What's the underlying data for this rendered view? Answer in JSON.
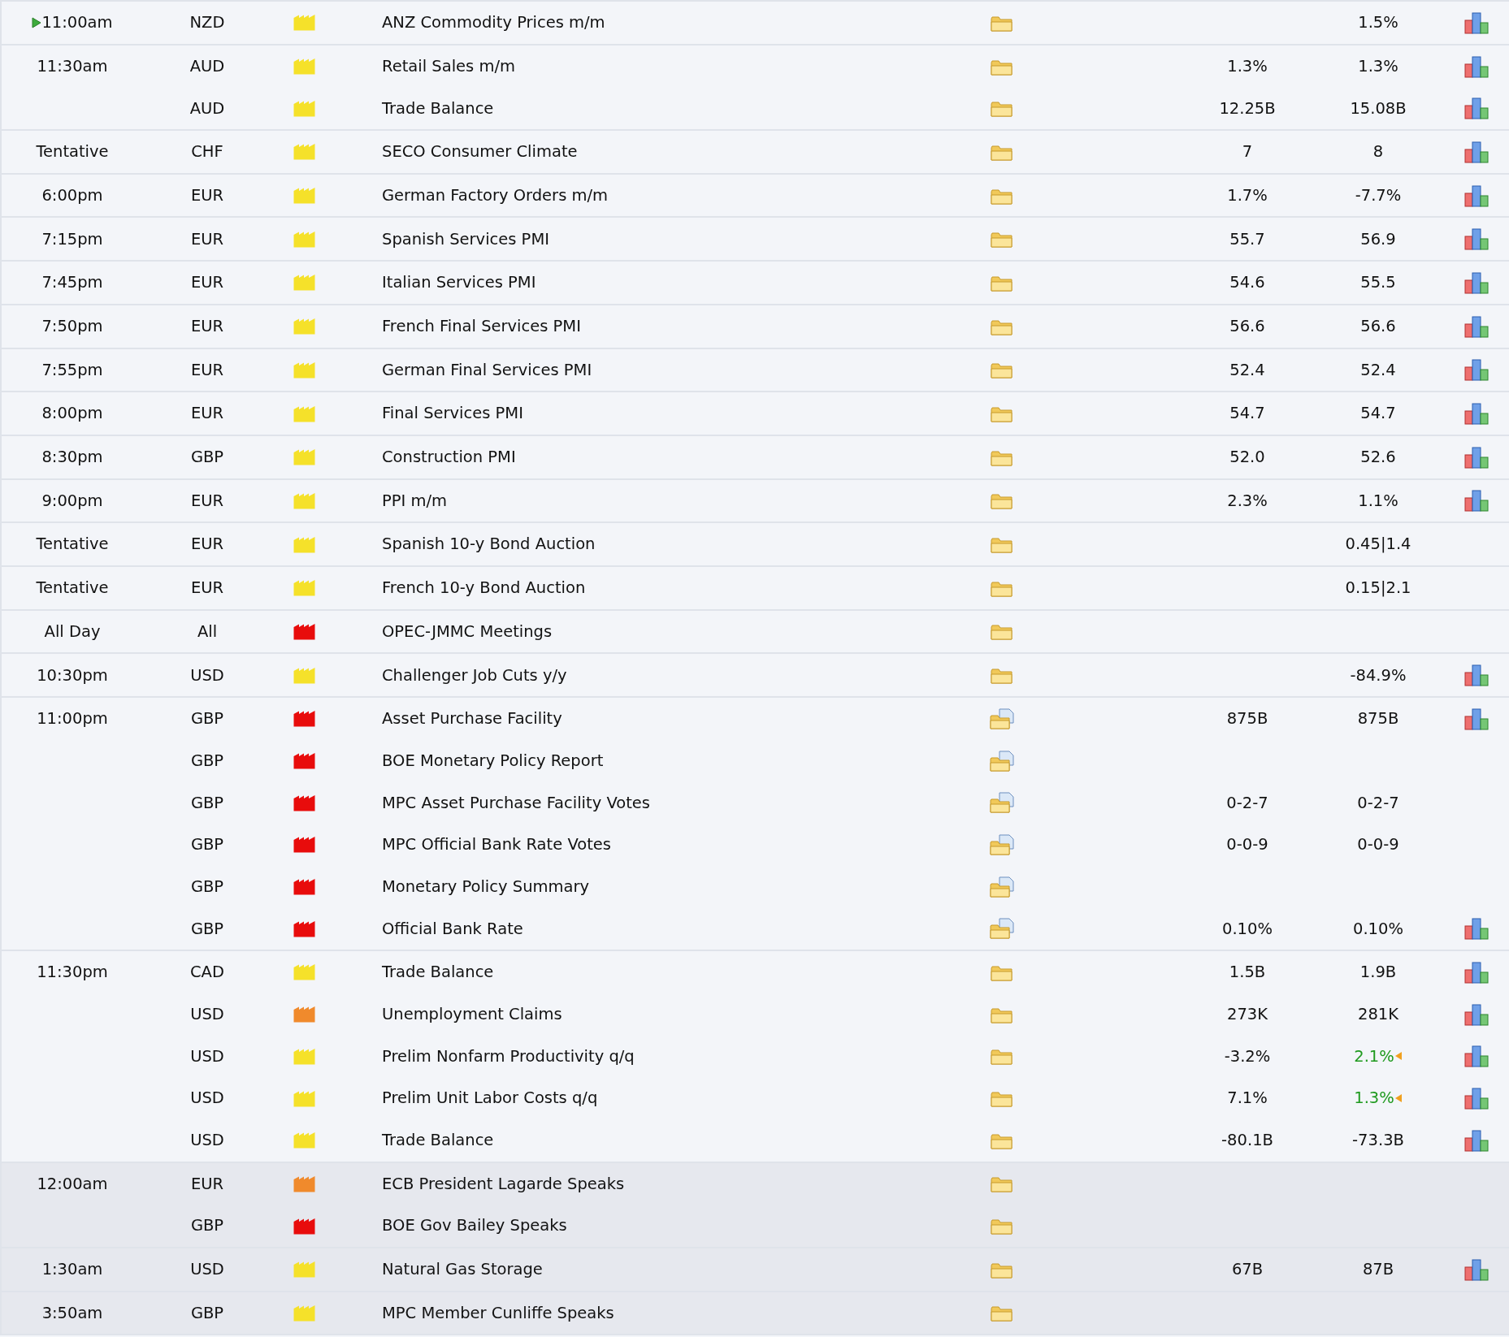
{
  "groups": [
    {
      "time": "11:00am",
      "next": true,
      "upcoming": false,
      "rows": [
        {
          "currency": "NZD",
          "color": "#f5e12a",
          "event": "ANZ Commodity Prices m/m",
          "kind": "folder",
          "column_7": "1.5%",
          "better": false,
          "chart": true
        }
      ]
    },
    {
      "time": "11:30am",
      "next": false,
      "upcoming": false,
      "rows": [
        {
          "currency": "AUD",
          "color": "#f5e12a",
          "event": "Retail Sales m/m",
          "kind": "folder",
          "column_6": "1.3%",
          "column_7": "1.3%",
          "better": false,
          "chart": true
        },
        {
          "currency": "AUD",
          "color": "#f5e12a",
          "event": "Trade Balance",
          "kind": "folder",
          "column_6": "12.25B",
          "column_7": "15.08B",
          "better": false,
          "chart": true
        }
      ]
    },
    {
      "time": "Tentative",
      "next": false,
      "upcoming": false,
      "rows": [
        {
          "currency": "CHF",
          "color": "#f5e12a",
          "event": "SECO Consumer Climate",
          "kind": "folder",
          "column_6": "7",
          "column_7": "8",
          "better": false,
          "chart": true
        }
      ]
    },
    {
      "time": "6:00pm",
      "next": false,
      "upcoming": false,
      "rows": [
        {
          "currency": "EUR",
          "color": "#f5e12a",
          "event": "German Factory Orders m/m",
          "kind": "folder",
          "column_6": "1.7%",
          "column_7": "-7.7%",
          "better": false,
          "chart": true
        }
      ]
    },
    {
      "time": "7:15pm",
      "next": false,
      "upcoming": false,
      "rows": [
        {
          "currency": "EUR",
          "color": "#f5e12a",
          "event": "Spanish Services PMI",
          "kind": "folder",
          "column_6": "55.7",
          "column_7": "56.9",
          "better": false,
          "chart": true
        }
      ]
    },
    {
      "time": "7:45pm",
      "next": false,
      "upcoming": false,
      "rows": [
        {
          "currency": "EUR",
          "color": "#f5e12a",
          "event": "Italian Services PMI",
          "kind": "folder",
          "column_6": "54.6",
          "column_7": "55.5",
          "better": false,
          "chart": true
        }
      ]
    },
    {
      "time": "7:50pm",
      "next": false,
      "upcoming": false,
      "rows": [
        {
          "currency": "EUR",
          "color": "#f5e12a",
          "event": "French Final Services PMI",
          "kind": "folder",
          "column_6": "56.6",
          "column_7": "56.6",
          "better": false,
          "chart": true
        }
      ]
    },
    {
      "time": "7:55pm",
      "next": false,
      "upcoming": false,
      "rows": [
        {
          "currency": "EUR",
          "color": "#f5e12a",
          "event": "German Final Services PMI",
          "kind": "folder",
          "column_6": "52.4",
          "column_7": "52.4",
          "better": false,
          "chart": true
        }
      ]
    },
    {
      "time": "8:00pm",
      "next": false,
      "upcoming": false,
      "rows": [
        {
          "currency": "EUR",
          "color": "#f5e12a",
          "event": "Final Services PMI",
          "kind": "folder",
          "column_6": "54.7",
          "column_7": "54.7",
          "better": false,
          "chart": true
        }
      ]
    },
    {
      "time": "8:30pm",
      "next": false,
      "upcoming": false,
      "rows": [
        {
          "currency": "GBP",
          "color": "#f5e12a",
          "event": "Construction PMI",
          "kind": "folder",
          "column_6": "52.0",
          "column_7": "52.6",
          "better": false,
          "chart": true
        }
      ]
    },
    {
      "time": "9:00pm",
      "next": false,
      "upcoming": false,
      "rows": [
        {
          "currency": "EUR",
          "color": "#f5e12a",
          "event": "PPI m/m",
          "kind": "folder",
          "column_6": "2.3%",
          "column_7": "1.1%",
          "better": false,
          "chart": true
        }
      ]
    },
    {
      "time": "Tentative",
      "next": false,
      "upcoming": false,
      "rows": [
        {
          "currency": "EUR",
          "color": "#f5e12a",
          "event": "Spanish 10-y Bond Auction",
          "kind": "folder",
          "column_7": "0.45|1.4",
          "better": false,
          "chart": false
        }
      ]
    },
    {
      "time": "Tentative",
      "next": false,
      "upcoming": false,
      "rows": [
        {
          "currency": "EUR",
          "color": "#f5e12a",
          "event": "French 10-y Bond Auction",
          "kind": "folder",
          "column_7": "0.15|2.1",
          "better": false,
          "chart": false
        }
      ]
    },
    {
      "time": "All Day",
      "next": false,
      "upcoming": false,
      "rows": [
        {
          "currency": "All",
          "color": "#e80c0c",
          "event": "OPEC-JMMC Meetings",
          "kind": "folder",
          "better": false,
          "chart": false
        }
      ]
    },
    {
      "time": "10:30pm",
      "next": false,
      "upcoming": false,
      "rows": [
        {
          "currency": "USD",
          "color": "#f5e12a",
          "event": "Challenger Job Cuts y/y",
          "kind": "folder",
          "column_7": "-84.9%",
          "better": false,
          "chart": true
        }
      ]
    },
    {
      "time": "11:00pm",
      "next": false,
      "upcoming": false,
      "rows": [
        {
          "currency": "GBP",
          "color": "#e80c0c",
          "event": "Asset Purchase Facility",
          "kind": "report",
          "column_6": "875B",
          "column_7": "875B",
          "better": false,
          "chart": true
        },
        {
          "currency": "GBP",
          "color": "#e80c0c",
          "event": "BOE Monetary Policy Report",
          "kind": "report",
          "better": false,
          "chart": false
        },
        {
          "currency": "GBP",
          "color": "#e80c0c",
          "event": "MPC Asset Purchase Facility Votes",
          "kind": "report",
          "column_6": "0-2-7",
          "column_7": "0-2-7",
          "better": false,
          "chart": false
        },
        {
          "currency": "GBP",
          "color": "#e80c0c",
          "event": "MPC Official Bank Rate Votes",
          "kind": "report",
          "column_6": "0-0-9",
          "column_7": "0-0-9",
          "better": false,
          "chart": false
        },
        {
          "currency": "GBP",
          "color": "#e80c0c",
          "event": "Monetary Policy Summary",
          "kind": "report",
          "better": false,
          "chart": false
        },
        {
          "currency": "GBP",
          "color": "#e80c0c",
          "event": "Official Bank Rate",
          "kind": "report",
          "column_6": "0.10%",
          "column_7": "0.10%",
          "better": false,
          "chart": true
        }
      ]
    },
    {
      "time": "11:30pm",
      "next": false,
      "upcoming": false,
      "rows": [
        {
          "currency": "CAD",
          "color": "#f5e12a",
          "event": "Trade Balance",
          "kind": "folder",
          "column_6": "1.5B",
          "column_7": "1.9B",
          "better": false,
          "chart": true
        },
        {
          "currency": "USD",
          "color": "#f08a2c",
          "event": "Unemployment Claims",
          "kind": "folder",
          "column_6": "273K",
          "column_7": "281K",
          "better": false,
          "chart": true
        },
        {
          "currency": "USD",
          "color": "#f5e12a",
          "event": "Prelim Nonfarm Productivity q/q",
          "kind": "folder",
          "column_6": "-3.2%",
          "column_7": "2.1%",
          "better": true,
          "chart": true
        },
        {
          "currency": "USD",
          "color": "#f5e12a",
          "event": "Prelim Unit Labor Costs q/q",
          "kind": "folder",
          "column_6": "7.1%",
          "column_7": "1.3%",
          "better": true,
          "chart": true
        },
        {
          "currency": "USD",
          "color": "#f5e12a",
          "event": "Trade Balance",
          "kind": "folder",
          "column_6": "-80.1B",
          "column_7": "-73.3B",
          "better": false,
          "chart": true
        }
      ]
    },
    {
      "time": "12:00am",
      "next": false,
      "upcoming": true,
      "rows": [
        {
          "currency": "EUR",
          "color": "#f08a2c",
          "event": "ECB President Lagarde Speaks",
          "kind": "folder",
          "better": false,
          "chart": false
        },
        {
          "currency": "GBP",
          "color": "#e80c0c",
          "event": "BOE Gov Bailey Speaks",
          "kind": "folder",
          "better": false,
          "chart": false
        }
      ]
    },
    {
      "time": "1:30am",
      "next": false,
      "upcoming": true,
      "rows": [
        {
          "currency": "USD",
          "color": "#f5e12a",
          "event": "Natural Gas Storage",
          "kind": "folder",
          "column_6": "67B",
          "column_7": "87B",
          "better": false,
          "chart": true
        }
      ]
    },
    {
      "time": "3:50am",
      "next": false,
      "upcoming": true,
      "rows": [
        {
          "currency": "GBP",
          "color": "#f5e12a",
          "event": "MPC Member Cunliffe Speaks",
          "kind": "folder",
          "better": false,
          "chart": false
        }
      ]
    }
  ]
}
